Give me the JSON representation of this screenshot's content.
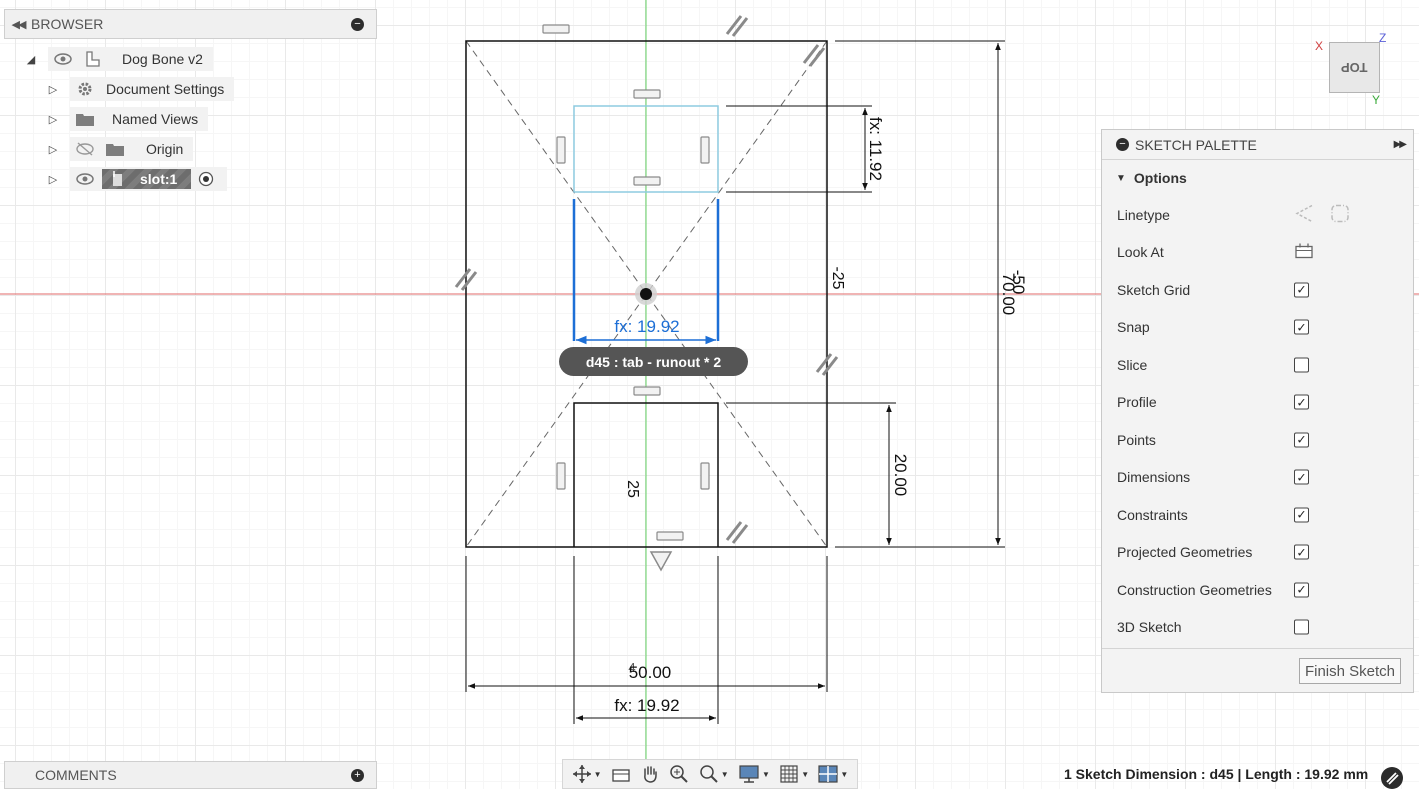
{
  "browser": {
    "title": "BROWSER",
    "collapse_icon": "double-left-arrow",
    "items": [
      {
        "label": "Dog Bone v2",
        "icon": "component-icon",
        "visible": true
      },
      {
        "label": "Document Settings",
        "icon": "gear-icon"
      },
      {
        "label": "Named Views",
        "icon": "folder-icon"
      },
      {
        "label": "Origin",
        "icon": "folder-icon",
        "visible": false
      },
      {
        "label": "slot:1",
        "icon": "body-icon",
        "visible": true
      }
    ]
  },
  "comments": {
    "title": "COMMENTS"
  },
  "palette": {
    "title": "SKETCH PALETTE",
    "section": "Options",
    "options": [
      {
        "label": "Linetype",
        "control": "linetype"
      },
      {
        "label": "Look At",
        "control": "lookat"
      },
      {
        "label": "Sketch Grid",
        "checked": true
      },
      {
        "label": "Snap",
        "checked": true
      },
      {
        "label": "Slice",
        "checked": false
      },
      {
        "label": "Profile",
        "checked": true
      },
      {
        "label": "Points",
        "checked": true
      },
      {
        "label": "Dimensions",
        "checked": true
      },
      {
        "label": "Constraints",
        "checked": true
      },
      {
        "label": "Projected Geometries",
        "checked": true
      },
      {
        "label": "Construction Geometries",
        "checked": true
      },
      {
        "label": "3D Sketch",
        "checked": false
      }
    ],
    "finish_label": "Finish Sketch"
  },
  "sketch": {
    "tooltip": "d45 : tab - runout * 2",
    "dimensions": {
      "fx_1192": "fx: 11.92",
      "fx_1992_active": "fx: 19.92",
      "neg25": "-25",
      "neg50": "-50",
      "d7000": "70.00",
      "d2000": "20.00",
      "d25": "25",
      "d5000": "50.00",
      "fx_1992_bottom": "fx: 19.92",
      "small_overlap": "4"
    }
  },
  "viewcube": {
    "face": "TOP",
    "x": "X",
    "y": "Y",
    "z": "Z"
  },
  "toolbar": {
    "buttons": [
      "orbit-icon",
      "look-at-icon",
      "pan-icon",
      "zoom-icon",
      "zoom-window-icon",
      "display-icon",
      "grid-icon",
      "viewports-icon"
    ]
  },
  "status": {
    "text": "1 Sketch Dimension : d45 | Length : 19.92 mm"
  },
  "colors": {
    "sketch_line": "#111111",
    "selected_line": "#1d6fd6",
    "light_blue": "#8ecbe0",
    "axis_red": "#e06a6a",
    "axis_green": "#63d163",
    "constraint_grey": "#8a8a8a"
  }
}
